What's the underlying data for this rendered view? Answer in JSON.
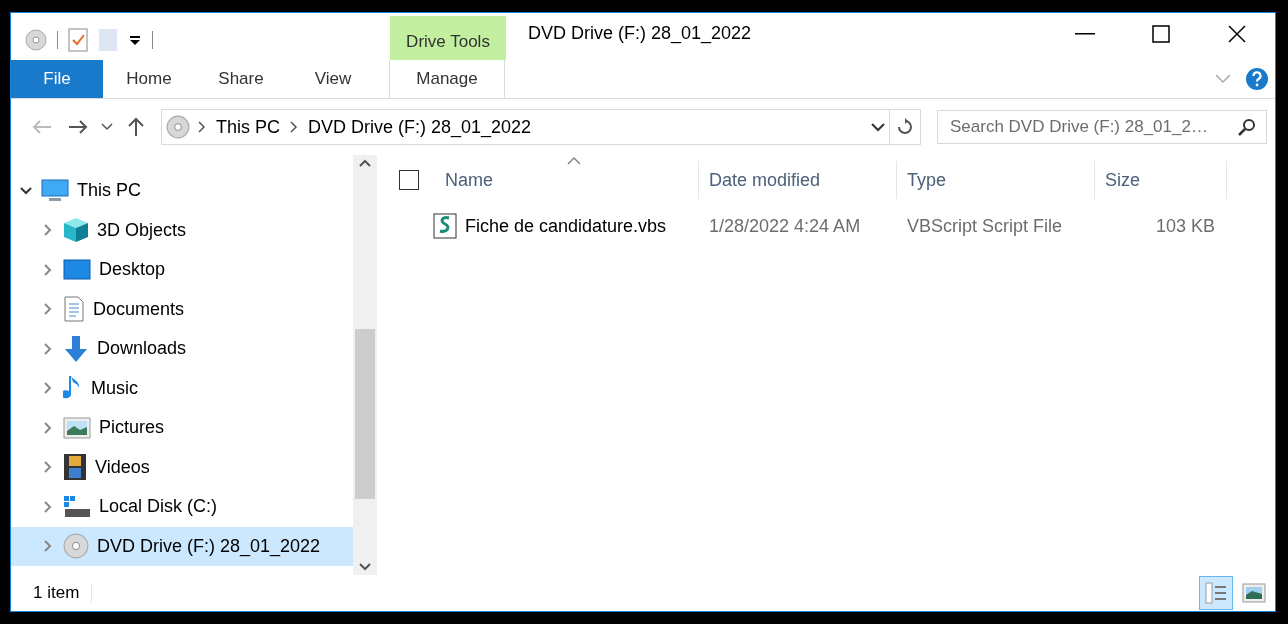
{
  "window": {
    "title": "DVD Drive (F:) 28_01_2022"
  },
  "contextual_group": {
    "label": "Drive Tools"
  },
  "ribbon_tabs": [
    {
      "label": "File",
      "kind": "file"
    },
    {
      "label": "Home",
      "kind": "plain"
    },
    {
      "label": "Share",
      "kind": "plain"
    },
    {
      "label": "View",
      "kind": "plain"
    },
    {
      "label": "Manage",
      "kind": "contextual"
    }
  ],
  "address": {
    "path": [
      "This PC",
      "DVD Drive (F:) 28_01_2022"
    ]
  },
  "search": {
    "placeholder": "Search DVD Drive (F:) 28_01_2…"
  },
  "navigation": [
    {
      "label": "This PC",
      "kind": "pc",
      "expanded": true,
      "selected": false,
      "children": [
        {
          "label": "3D Objects",
          "kind": "cube",
          "expanded": false,
          "selected": false
        },
        {
          "label": "Desktop",
          "kind": "desktop",
          "expanded": false,
          "selected": false
        },
        {
          "label": "Documents",
          "kind": "document",
          "expanded": false,
          "selected": false
        },
        {
          "label": "Downloads",
          "kind": "download",
          "expanded": false,
          "selected": false
        },
        {
          "label": "Music",
          "kind": "music",
          "expanded": false,
          "selected": false
        },
        {
          "label": "Pictures",
          "kind": "pictures",
          "expanded": false,
          "selected": false
        },
        {
          "label": "Videos",
          "kind": "videos",
          "expanded": false,
          "selected": false
        },
        {
          "label": "Local Disk (C:)",
          "kind": "disk",
          "expanded": false,
          "selected": false
        },
        {
          "label": "DVD Drive (F:) 28_01_2022",
          "kind": "dvd",
          "expanded": false,
          "selected": true
        }
      ]
    }
  ],
  "select_all": {
    "checked": false
  },
  "columns": [
    {
      "label": "Name",
      "sorted": true
    },
    {
      "label": "Date modified",
      "sorted": false
    },
    {
      "label": "Type",
      "sorted": false
    },
    {
      "label": "Size",
      "sorted": false
    }
  ],
  "files": [
    {
      "name": "Fiche de candidature.vbs",
      "date_modified": "1/28/2022 4:24 AM",
      "type": "VBScript Script File",
      "size": "103 KB",
      "selected": false
    }
  ],
  "status_bar": {
    "item_count": "1 item",
    "views": [
      {
        "kind": "details",
        "selected": true
      },
      {
        "kind": "large_icons",
        "selected": false
      }
    ]
  }
}
